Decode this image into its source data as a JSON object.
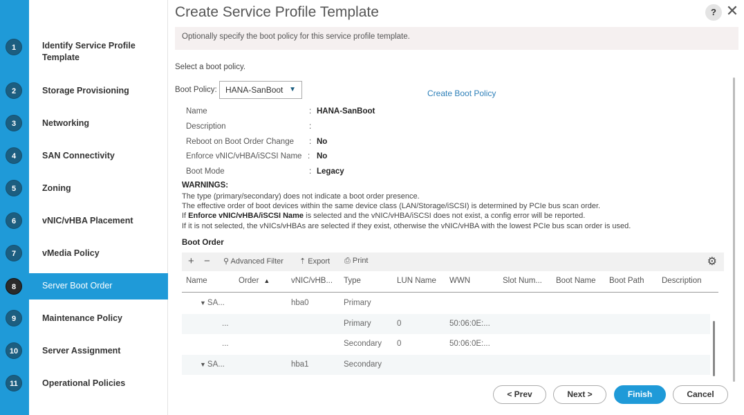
{
  "wizard": {
    "steps": [
      {
        "num": "1",
        "label": "Identify Service Profile Template",
        "active": false
      },
      {
        "num": "2",
        "label": "Storage Provisioning",
        "active": false
      },
      {
        "num": "3",
        "label": "Networking",
        "active": false
      },
      {
        "num": "4",
        "label": "SAN Connectivity",
        "active": false
      },
      {
        "num": "5",
        "label": "Zoning",
        "active": false
      },
      {
        "num": "6",
        "label": "vNIC/vHBA Placement",
        "active": false
      },
      {
        "num": "7",
        "label": "vMedia Policy",
        "active": false
      },
      {
        "num": "8",
        "label": "Server Boot Order",
        "active": true
      },
      {
        "num": "9",
        "label": "Maintenance Policy",
        "active": false
      },
      {
        "num": "10",
        "label": "Server Assignment",
        "active": false
      },
      {
        "num": "11",
        "label": "Operational Policies",
        "active": false
      }
    ]
  },
  "header": {
    "title": "Create Service Profile Template",
    "help_label": "?",
    "close_label": "✕"
  },
  "info": "Optionally specify the boot policy for this service profile template.",
  "select_prompt": "Select a boot policy.",
  "boot_policy": {
    "label": "Boot Policy:",
    "selected": "HANA-SanBoot",
    "create_link": "Create Boot Policy"
  },
  "properties": [
    {
      "key": "Name",
      "value": "HANA-SanBoot"
    },
    {
      "key": "Description",
      "value": ""
    },
    {
      "key": "Reboot on Boot Order Change",
      "value": "No"
    },
    {
      "key": "Enforce vNIC/vHBA/iSCSI Name",
      "value": "No"
    },
    {
      "key": "Boot Mode",
      "value": "Legacy"
    }
  ],
  "warnings": {
    "title": "WARNINGS:",
    "line1": "The type (primary/secondary) does not indicate a boot order presence.",
    "line2": "The effective order of boot devices within the same device class (LAN/Storage/iSCSI) is determined by PCIe bus scan order.",
    "line3_prefix": "If ",
    "line3_bold": "Enforce vNIC/vHBA/iSCSI Name",
    "line3_suffix": " is selected and the vNIC/vHBA/iSCSI does not exist, a config error will be reported.",
    "line4": "If it is not selected, the vNICs/vHBAs are selected if they exist, otherwise the vNIC/vHBA with the lowest PCIe bus scan order is used."
  },
  "boot_order": {
    "title": "Boot Order",
    "toolbar": {
      "add": "+",
      "remove": "−",
      "filter": "Advanced Filter",
      "export": "Export",
      "print": "Print"
    },
    "columns": [
      "Name",
      "Order",
      "vNIC/vHB...",
      "Type",
      "LUN Name",
      "WWN",
      "Slot Num...",
      "Boot Name",
      "Boot Path",
      "Description"
    ],
    "rows": [
      {
        "name": "SA...",
        "expand": true,
        "vnic": "hba0",
        "type": "Primary",
        "lun": "",
        "wwn": ""
      },
      {
        "name": "...",
        "expand": false,
        "vnic": "",
        "type": "Primary",
        "lun": "0",
        "wwn": "50:06:0E:..."
      },
      {
        "name": "...",
        "expand": false,
        "vnic": "",
        "type": "Secondary",
        "lun": "0",
        "wwn": "50:06:0E:..."
      },
      {
        "name": "SA...",
        "expand": true,
        "vnic": "hba1",
        "type": "Secondary",
        "lun": "",
        "wwn": ""
      }
    ]
  },
  "footer": {
    "prev": "< Prev",
    "next": "Next >",
    "finish": "Finish",
    "cancel": "Cancel"
  }
}
